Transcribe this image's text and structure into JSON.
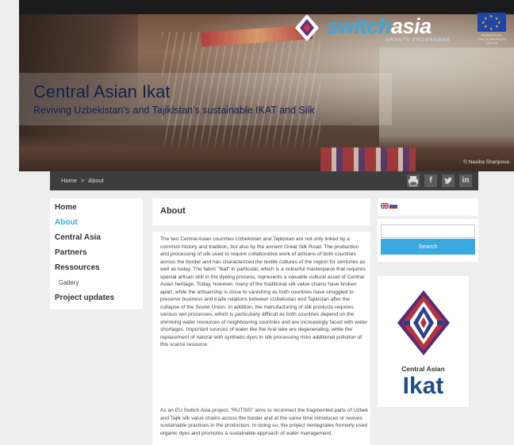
{
  "hero": {
    "title": "Central Asian Ikat",
    "subtitle": "Reviving Uzbekistan’s and Tajikistan’s sustainable IKAT and Silk",
    "photo_credit": "© Nasiba Sharipova",
    "logo_word_a": "switch",
    "logo_word_b": "asia",
    "logo_programme": "GRANTS PROGRAMME",
    "eu_caption": "FUNDED BY THE EUROPEAN UNION"
  },
  "breadcrumb": {
    "home": "Home",
    "separator": ">",
    "current": "About"
  },
  "social_icons": [
    "print-icon",
    "facebook-icon",
    "twitter-icon",
    "linkedin-icon"
  ],
  "nav": {
    "items": [
      {
        "label": "Home",
        "active": false
      },
      {
        "label": "About",
        "active": true
      },
      {
        "label": "Central Asia",
        "active": false
      },
      {
        "label": "Partners",
        "active": false
      },
      {
        "label": "Ressources",
        "active": false
      },
      {
        "label": "Gallery",
        "sub": true
      },
      {
        "label": "Project updates",
        "active": false
      }
    ]
  },
  "main": {
    "title": "About",
    "paragraphs": [
      "The two Central Asian countries Uzbekistan and Tajikistan are not only linked by a common history and tradition, but also by the ancient Great Silk Road. The production and processing of silk used to require collaborative work of artisans of both countries across the border and has characterized the textile cultures of the region for centuries as well as today. The fabric \"Ikat\" in particular, which is a colourful masterpiece that requires special artisan skill in the dyeing process, represents a valuable cultural asset of Central Asian heritage. Today, however, many of the traditional silk value chains have broken apart, while the artisanship is close to vanishing as both countries have struggled to preserve business and trade relations between Uzbekistan and Tajikistan after the collapse of the Soviet Union. In addition, the manufacturing of silk products requires various wet processes, which is particularly difficult as both countries depend on the shrinking water resources of neighbouring countries and are increasingly faced with water shortages. Important sources of water like the Aral lake are degenerating, while the replacement of natural with synthetic dyes in silk processing risks additional pollution of this scarce resource.",
      "As an EU Switch Asia project, \"RUTSIS\" aims to reconnect the fragmented parts of Uzbek and Tajik silk value chains across the border and at the same time introduces or revives sustainable practices in the production. In doing so, the project reintegrates formerly used organic dyes and promotes a sustainable approach of water management."
    ]
  },
  "languages": [
    "uk-flag-icon",
    "russia-flag-icon"
  ],
  "search": {
    "placeholder": "",
    "button_label": "Search"
  },
  "brand": {
    "small": "Central Asian",
    "big": "Ikat"
  },
  "colors": {
    "accent": "#39a9e0",
    "brand_blue": "#1f4e89",
    "bar": "#3d3d3d"
  }
}
